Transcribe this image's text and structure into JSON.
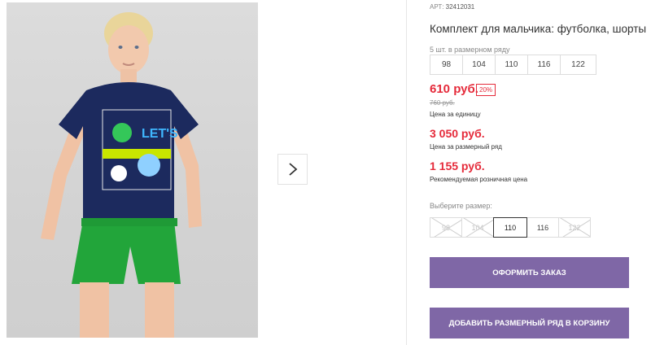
{
  "product": {
    "article_label": "АРТ:",
    "article_value": "32412031",
    "title": "Комплект для мальчика: футболка, шорты",
    "size_row_note": "5 шт. в размерном ряду",
    "size_row": [
      "98",
      "104",
      "110",
      "116",
      "122"
    ],
    "price_main": "610 руб.",
    "discount_badge": "20%",
    "price_old": "760 руб.",
    "price_unit_label": "Цена за единицу",
    "price_row": "3 050 руб.",
    "price_row_label": "Цена за размерный ряд",
    "price_retail": "1 155 руб.",
    "price_retail_label": "Рекомендуемая розничная цена",
    "choose_size_label": "Выберите размер:",
    "pick_sizes": [
      {
        "label": "98",
        "state": "disabled"
      },
      {
        "label": "104",
        "state": "disabled"
      },
      {
        "label": "110",
        "state": "selected"
      },
      {
        "label": "116",
        "state": "available"
      },
      {
        "label": "122",
        "state": "disabled"
      }
    ],
    "order_button": "ОФОРМИТЬ ЗАКАЗ",
    "add_row_button": "ДОБАВИТЬ РАЗМЕРНЫЙ РЯД В КОРЗИНУ"
  },
  "gallery": {
    "next_icon": "chevron-right-icon",
    "shirt_print": "LET'S"
  },
  "colors": {
    "accent_price": "#e52a3a",
    "button": "#7f67a6",
    "shirt": "#1c2a5e",
    "shorts": "#22a53a"
  }
}
